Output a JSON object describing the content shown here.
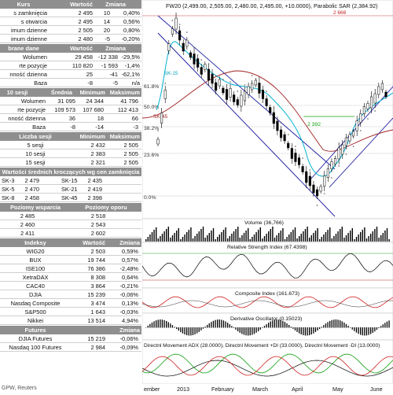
{
  "kurs": {
    "headers": [
      "Kurs",
      "Wartość",
      "Zmiana"
    ],
    "rows": [
      [
        "s zamknięcia",
        "2 495",
        "10",
        "0,40%"
      ],
      [
        "s otwarcia",
        "2 495",
        "14",
        "0,56%"
      ],
      [
        "imum dzienne",
        "2 505",
        "20",
        "0,80%"
      ],
      [
        "imum dzienne",
        "2 480",
        "-5",
        "-0,20%"
      ]
    ]
  },
  "wybrane": {
    "headers": [
      "brane dane",
      "Wartość",
      "Zmiana"
    ],
    "rows": [
      [
        "Wolumen",
        "29 458",
        "-12 338",
        "-29,5%"
      ],
      [
        "rte pozycje",
        "110 820",
        "-1 593",
        "-1,4%"
      ],
      [
        "nność dzienna",
        "25",
        "-41",
        "-62,1%"
      ],
      [
        "Baza",
        "-8",
        "-5",
        "n/a"
      ]
    ]
  },
  "sesje10": {
    "headers": [
      "10 sesji",
      "Średnia",
      "Minimum",
      "Maksimum"
    ],
    "rows": [
      [
        "Wolumen",
        "31 095",
        "24 344",
        "41 796"
      ],
      [
        "rte pozycje",
        "109 573",
        "107 680",
        "112 413"
      ],
      [
        "nność dzienna",
        "36",
        "18",
        "66"
      ],
      [
        "Baza",
        "-8",
        "-14",
        "-3"
      ]
    ]
  },
  "liczba": {
    "headers": [
      "Liczba sesji",
      "Minimum",
      "Maksimum"
    ],
    "rows": [
      [
        "5 sesji",
        "2 432",
        "2 505"
      ],
      [
        "10 sesji",
        "2 383",
        "2 505"
      ],
      [
        "15 sesji",
        "2 321",
        "2 505"
      ]
    ]
  },
  "srednie": {
    "header": "Wartości średnich kroczących wg cen zamknięcia",
    "rows": [
      [
        "SK-3",
        "2 479",
        "SK-15",
        "2 435"
      ],
      [
        "SK-5",
        "2 470",
        "SK-21",
        "2 419"
      ],
      [
        "SK-8",
        "2 458",
        "SK-45",
        "2 398"
      ]
    ]
  },
  "poziomy": {
    "headers": [
      "Poziomy wsparcia",
      "Poziomy oporu"
    ],
    "rows": [
      [
        "2 485",
        "2 518"
      ],
      [
        "2 460",
        "2 543"
      ],
      [
        "2 411",
        "2 602"
      ]
    ]
  },
  "indeksy": {
    "headers": [
      "Indeksy",
      "Wartość",
      "Zmiana"
    ],
    "rows": [
      [
        "WIG20",
        "2 503",
        "0,59%"
      ],
      [
        "BUX",
        "19 744",
        "0,57%"
      ],
      [
        "ISE100",
        "76 386",
        "-2,48%"
      ],
      [
        "XetraDAX",
        "8 308",
        "0,64%"
      ],
      [
        "CAC40",
        "3 864",
        "-0,21%"
      ],
      [
        "DJIA",
        "15 239",
        "-0,06%"
      ],
      [
        "Nasdaq Composite",
        "3 474",
        "0,13%"
      ],
      [
        "S&P500",
        "1 643",
        "-0,03%"
      ],
      [
        "Nikkei",
        "13 514",
        "4,94%"
      ]
    ]
  },
  "futures": {
    "headers": [
      "Futures",
      "Zmiana"
    ],
    "rows": [
      [
        "DJIA Futures",
        "15 219",
        "-0,06%"
      ],
      [
        "Nasdaq 100 Futures",
        "2 984",
        "-0,09%"
      ]
    ]
  },
  "footer": "GPW, Reuters",
  "chart": {
    "title": "FW20 (2,499.00, 2,505.00, 2,480.00, 2,495.00, +10.0000), Parabolic SAR (2,384.92)",
    "top_label": "2 666",
    "fib": [
      "61.8%",
      "50.0%",
      "38.2%",
      "23.6%",
      "0.0%"
    ],
    "ma_labels": [
      "SK-15",
      "SK-45",
      "2 392"
    ],
    "volume_title": "Volume (36,766)",
    "rsi_title": "Relative Strength Index (67.4398)",
    "composite_title": "Composite Index (161.673)",
    "deriv_title": "Derivative Oscillator (0.15023)",
    "dmi_title": "Directnl Movement ADX (28.0000), Directnl Movement +DI (33.0000), Directnl Movement -DI (13.0000)",
    "x_labels": [
      "ember",
      "2013",
      "February",
      "March",
      "April",
      "May",
      "June"
    ],
    "colors": {
      "price": "#000000",
      "sar": "#777777",
      "ma_fast": "#00b0d0",
      "ma_slow": "#a02020",
      "channel": "#1a1aa0",
      "rsi": "#000000",
      "composite": "#d02020",
      "dmi_adx": "#000000",
      "dmi_plus": "#10a010",
      "dmi_minus": "#d02020",
      "band": "#c0a0a0"
    }
  }
}
